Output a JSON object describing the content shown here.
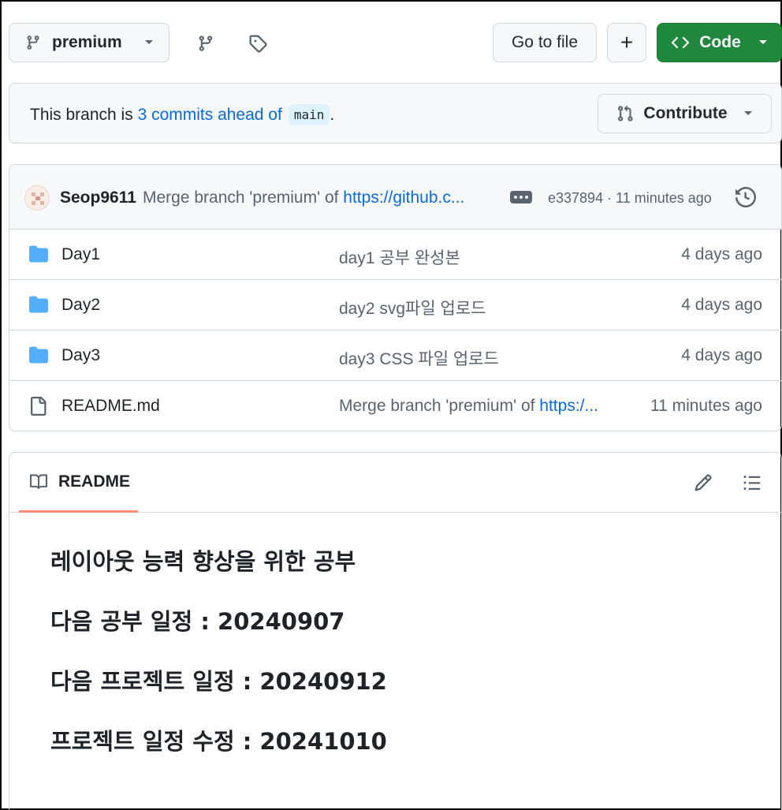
{
  "toolbar": {
    "branch_name": "premium",
    "go_to_file": "Go to file",
    "add_symbol": "+",
    "code_label": "Code",
    "colors": {
      "code_button": "#1f883d",
      "link": "#0969da"
    }
  },
  "branch_info": {
    "prefix": "This branch is",
    "commits_link": "3 commits ahead of",
    "base_branch": "main",
    "suffix": ".",
    "contribute_label": "Contribute"
  },
  "latest_commit": {
    "author": "Seop9611",
    "message_prefix": "Merge branch 'premium' of",
    "message_link": "https://github.c...",
    "meta": "e337894 · 11 minutes ago"
  },
  "files": [
    {
      "name": "Day1",
      "type": "folder",
      "message": "day1 공부 완성본",
      "message_link": "",
      "time": "4 days ago"
    },
    {
      "name": "Day2",
      "type": "folder",
      "message": "day2 svg파일 업로드",
      "message_link": "",
      "time": "4 days ago"
    },
    {
      "name": "Day3",
      "type": "folder",
      "message": "day3 CSS 파일 업로드",
      "message_link": "",
      "time": "4 days ago"
    },
    {
      "name": "README.md",
      "type": "file",
      "message": "Merge branch 'premium' of ",
      "message_link": "https:/...",
      "time": "11 minutes ago"
    }
  ],
  "readme": {
    "tab_label": "README",
    "lines": [
      "레이아웃 능력 향상을 위한 공부",
      "다음 공부 일정 : 20240907",
      "다음 프로젝트 일정 : 20240912",
      "프로젝트 일정 수정 : 20241010"
    ]
  }
}
